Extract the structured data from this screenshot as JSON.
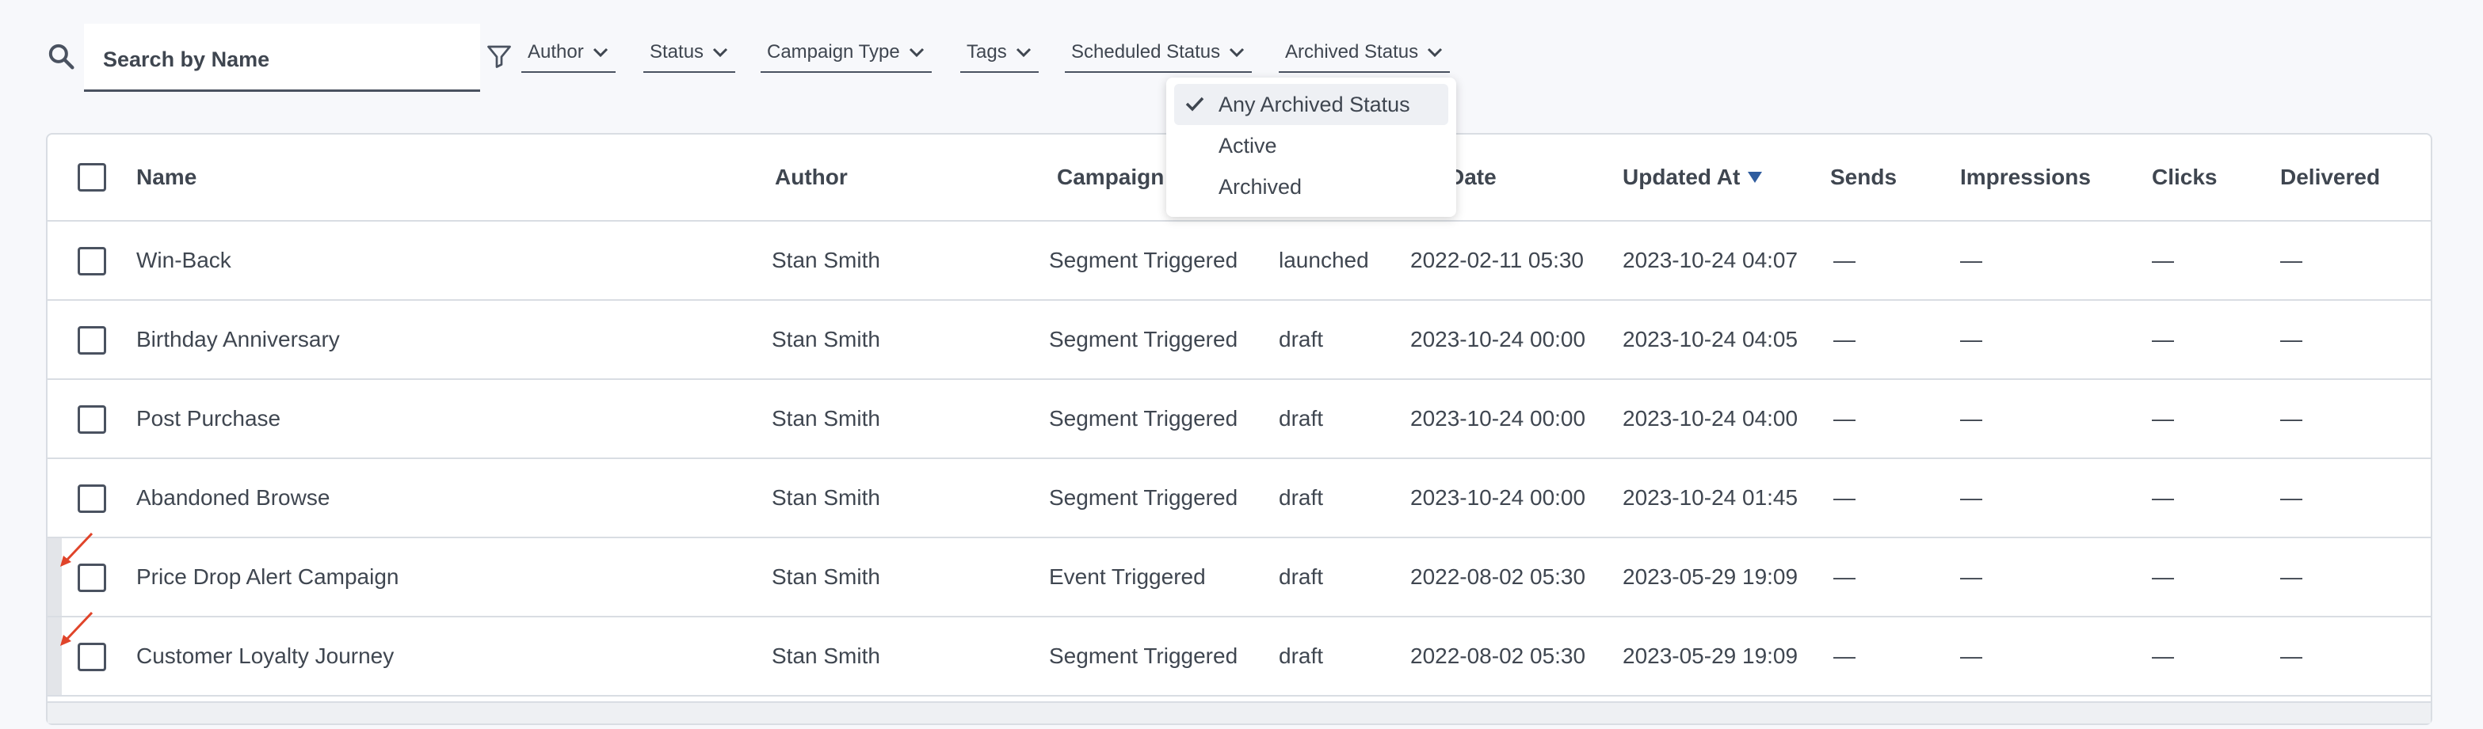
{
  "search": {
    "placeholder": "Search by Name",
    "value": ""
  },
  "filters": [
    {
      "label": "Author"
    },
    {
      "label": "Status"
    },
    {
      "label": "Campaign Type"
    },
    {
      "label": "Tags"
    },
    {
      "label": "Scheduled Status"
    },
    {
      "label": "Archived Status"
    }
  ],
  "dropdown": {
    "items": [
      {
        "label": "Any Archived Status",
        "selected": true
      },
      {
        "label": "Active",
        "selected": false
      },
      {
        "label": "Archived",
        "selected": false
      }
    ]
  },
  "table": {
    "columns": {
      "name": "Name",
      "author": "Author",
      "campaign": "Campaign",
      "start_date": "rt Date",
      "updated_at": "Updated At",
      "sends": "Sends",
      "impressions": "Impressions",
      "clicks": "Clicks",
      "delivered": "Delivered"
    },
    "rows": [
      {
        "name": "Win-Back",
        "author": "Stan Smith",
        "campaign": "Segment Triggered",
        "status": "launched",
        "start": "2022-02-11 05:30",
        "updated": "2023-10-24 04:07",
        "sends": "—",
        "impressions": "—",
        "clicks": "—",
        "delivered": "—"
      },
      {
        "name": "Birthday Anniversary",
        "author": "Stan Smith",
        "campaign": "Segment Triggered",
        "status": "draft",
        "start": "2023-10-24 00:00",
        "updated": "2023-10-24 04:05",
        "sends": "—",
        "impressions": "—",
        "clicks": "—",
        "delivered": "—"
      },
      {
        "name": "Post Purchase",
        "author": "Stan Smith",
        "campaign": "Segment Triggered",
        "status": "draft",
        "start": "2023-10-24 00:00",
        "updated": "2023-10-24 04:00",
        "sends": "—",
        "impressions": "—",
        "clicks": "—",
        "delivered": "—"
      },
      {
        "name": "Abandoned Browse",
        "author": "Stan Smith",
        "campaign": "Segment Triggered",
        "status": "draft",
        "start": "2023-10-24 00:00",
        "updated": "2023-10-24 01:45",
        "sends": "—",
        "impressions": "—",
        "clicks": "—",
        "delivered": "—"
      },
      {
        "name": "Price Drop Alert Campaign",
        "author": "Stan Smith",
        "campaign": "Event Triggered",
        "status": "draft",
        "start": "2022-08-02 05:30",
        "updated": "2023-05-29 19:09",
        "sends": "—",
        "impressions": "—",
        "clicks": "—",
        "delivered": "—"
      },
      {
        "name": "Customer Loyalty Journey",
        "author": "Stan Smith",
        "campaign": "Segment Triggered",
        "status": "draft",
        "start": "2022-08-02 05:30",
        "updated": "2023-05-29 19:09",
        "sends": "—",
        "impressions": "—",
        "clicks": "—",
        "delivered": "—"
      }
    ]
  },
  "colors": {
    "annotation_arrow": "#e0442a",
    "sort_arrow": "#2f5c9e",
    "text": "#3f4650",
    "border": "#d9dde3"
  }
}
